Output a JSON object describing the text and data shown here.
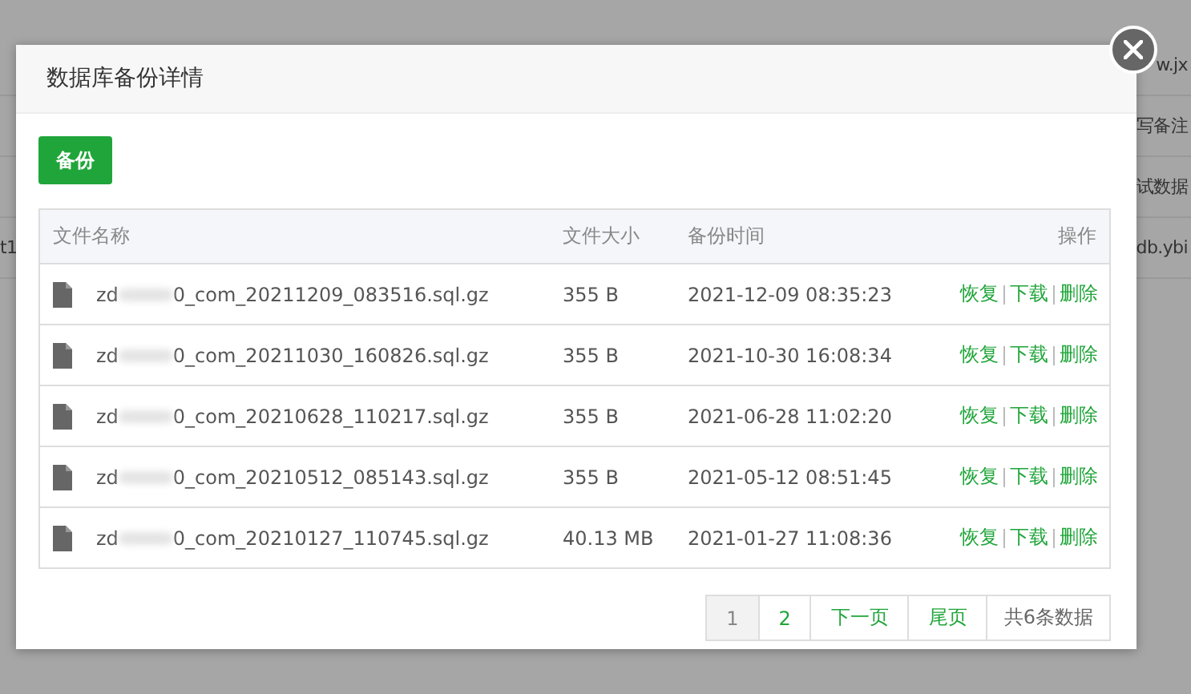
{
  "background_rows": [
    {
      "left": "",
      "right": "w.jx"
    },
    {
      "left": "",
      "right": "写备注"
    },
    {
      "left": "",
      "right": "试数据"
    },
    {
      "left": "t1",
      "right": "db.ybi"
    }
  ],
  "dialog": {
    "title": "数据库备份详情",
    "backup_button": "备份",
    "table": {
      "columns": [
        "文件名称",
        "文件大小",
        "备份时间",
        "操作"
      ],
      "rows": [
        {
          "name_start": "zd",
          "name_end": "0_com_20211209_083516.sql.gz",
          "size": "355 B",
          "time": "2021-12-09 08:35:23",
          "actions": [
            "恢复",
            "下载",
            "删除"
          ]
        },
        {
          "name_start": "zd",
          "name_end": "0_com_20211030_160826.sql.gz",
          "size": "355 B",
          "time": "2021-10-30 16:08:34",
          "actions": [
            "恢复",
            "下载",
            "删除"
          ]
        },
        {
          "name_start": "zd",
          "name_end": "0_com_20210628_110217.sql.gz",
          "size": "355 B",
          "time": "2021-06-28 11:02:20",
          "actions": [
            "恢复",
            "下载",
            "删除"
          ]
        },
        {
          "name_start": "zd",
          "name_end": "0_com_20210512_085143.sql.gz",
          "size": "355 B",
          "time": "2021-05-12 08:51:45",
          "actions": [
            "恢复",
            "下载",
            "删除"
          ]
        },
        {
          "name_start": "zd",
          "name_end": "0_com_20210127_110745.sql.gz",
          "size": "40.13 MB",
          "time": "2021-01-27 11:08:36",
          "actions": [
            "恢复",
            "下载",
            "删除"
          ]
        }
      ]
    },
    "pagination": [
      {
        "label": "1",
        "selected": true
      },
      {
        "label": "2",
        "selected": false
      },
      {
        "label": "下一页",
        "selected": false
      },
      {
        "label": "尾页",
        "selected": false
      }
    ],
    "total": "共6条数据"
  }
}
